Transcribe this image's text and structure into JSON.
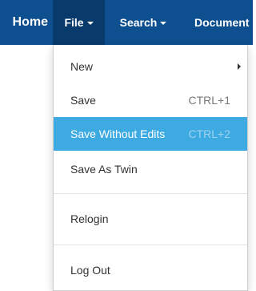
{
  "navbar": {
    "home_label": "Home",
    "file_label": "File",
    "search_label": "Search",
    "document_label": "Document",
    "background": "#0e4f8f",
    "active_background": "#083a6c"
  },
  "file_menu": {
    "items": [
      {
        "label": "New",
        "shortcut": "",
        "has_submenu": true
      },
      {
        "label": "Save",
        "shortcut": "CTRL+1"
      },
      {
        "label": "Save Without Edits",
        "shortcut": "CTRL+2",
        "highlighted": true
      },
      {
        "label": "Save As Twin",
        "shortcut": ""
      },
      {
        "label": "Relogin",
        "shortcut": ""
      },
      {
        "label": "Log Out",
        "shortcut": ""
      }
    ],
    "highlight_color": "#3daae1"
  }
}
